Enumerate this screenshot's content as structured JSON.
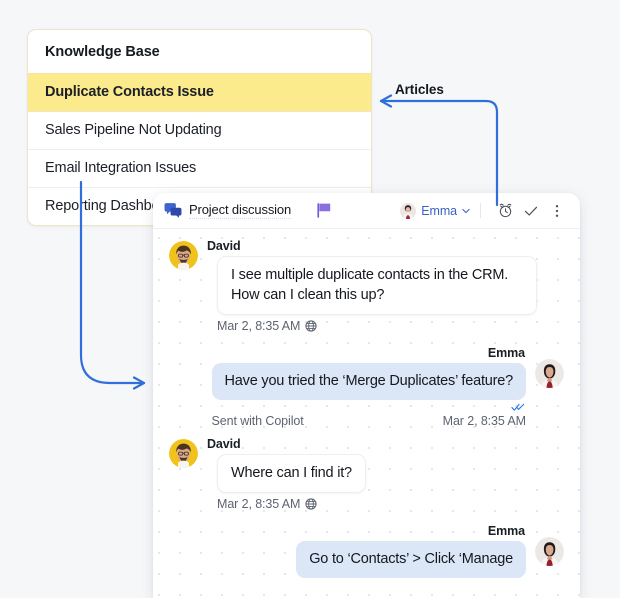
{
  "colors": {
    "page_bg": "#f6f7f9",
    "highlight_yellow": "#fbeb8d",
    "arrow_blue": "#2f6fdb",
    "outgoing_bubble": "#dbe6f7",
    "link_blue": "#3a62c4",
    "flag_purple": "#7a5bd6"
  },
  "knowledge_base": {
    "title": "Knowledge Base",
    "items": [
      {
        "label": "Duplicate Contacts Issue",
        "selected": true
      },
      {
        "label": "Sales Pipeline Not Updating",
        "selected": false
      },
      {
        "label": "Email Integration Issues",
        "selected": false
      },
      {
        "label": "Reporting Dashboard Not Showing Updated Data",
        "selected": false
      }
    ]
  },
  "annotations": {
    "articles_label": "Articles"
  },
  "chat": {
    "header": {
      "title": "Project discussion",
      "chat_icon": "chat-bubbles-icon",
      "flag_icon": "flag-icon",
      "assignee_name": "Emma",
      "chevron_icon": "chevron-down-icon",
      "reminder_icon": "alarm-clock-icon",
      "resolve_icon": "checkmark-icon",
      "more_icon": "more-vertical-icon"
    },
    "messages": [
      {
        "sender": "David",
        "direction": "in",
        "text": "I see multiple duplicate contacts in the CRM. How can I clean this up?",
        "timestamp": "Mar 2, 8:35 AM",
        "channel_icon": "globe-icon"
      },
      {
        "sender": "Emma",
        "direction": "out",
        "text": "Have you tried the ‘Merge Duplicates’ feature?",
        "note": "Sent with Copilot",
        "timestamp": "Mar 2, 8:35 AM",
        "status_icon": "double-check-icon"
      },
      {
        "sender": "David",
        "direction": "in",
        "text": "Where can I find it?",
        "timestamp": "Mar 2, 8:35 AM",
        "channel_icon": "globe-icon"
      },
      {
        "sender": "Emma",
        "direction": "out",
        "text": "Go to ‘Contacts’ > Click ‘Manage",
        "note": "",
        "timestamp": "",
        "status_icon": ""
      }
    ]
  }
}
